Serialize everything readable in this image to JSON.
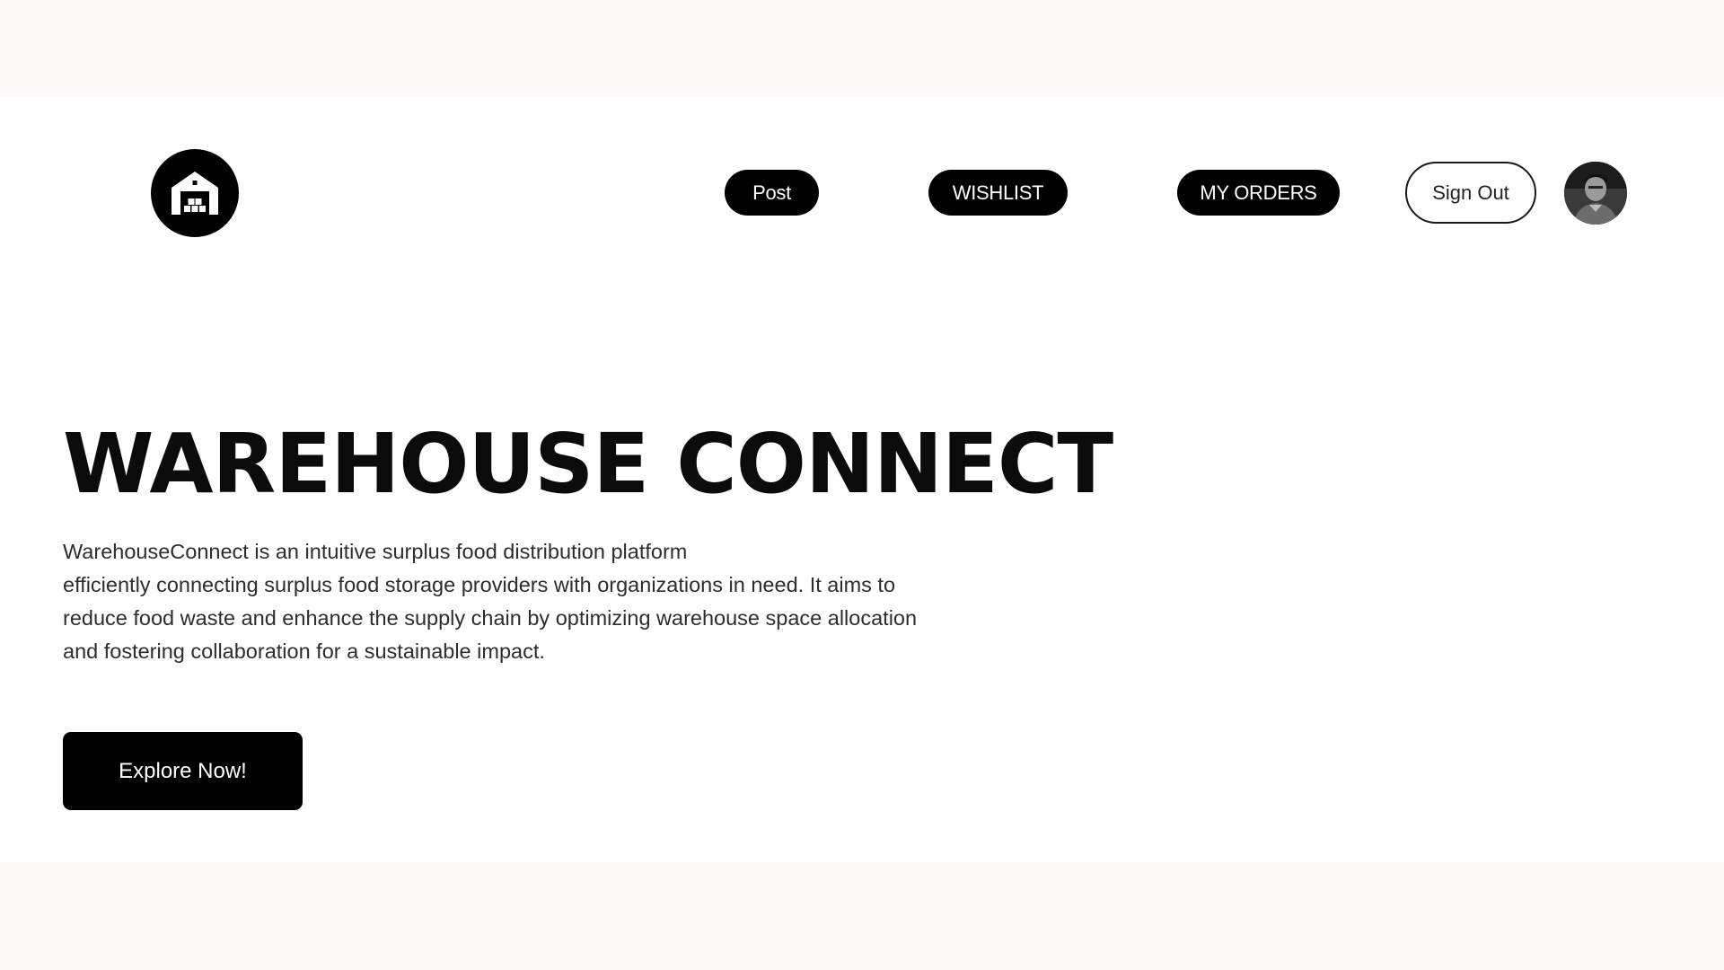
{
  "header": {
    "logo_icon": "warehouse-icon",
    "nav": {
      "post_label": "Post",
      "wishlist_label": "WISHLIST",
      "orders_label": "MY ORDERS",
      "signout_label": "Sign Out"
    },
    "avatar_icon": "user-avatar"
  },
  "hero": {
    "title": "WAREHOUSE CONNECT",
    "description_lines": [
      "WarehouseConnect is an intuitive surplus food distribution platform",
      "efficiently connecting surplus food storage providers with organizations in need. It aims to",
      "reduce food waste and enhance the supply chain by optimizing warehouse space allocation",
      "and fostering collaboration for a sustainable impact."
    ],
    "cta_label": "Explore Now!"
  },
  "colors": {
    "background": "#fcfbfa",
    "surface": "#ffffff",
    "primary": "#000000",
    "text": "#0b0b0b",
    "muted_text": "#2d2d2d"
  }
}
